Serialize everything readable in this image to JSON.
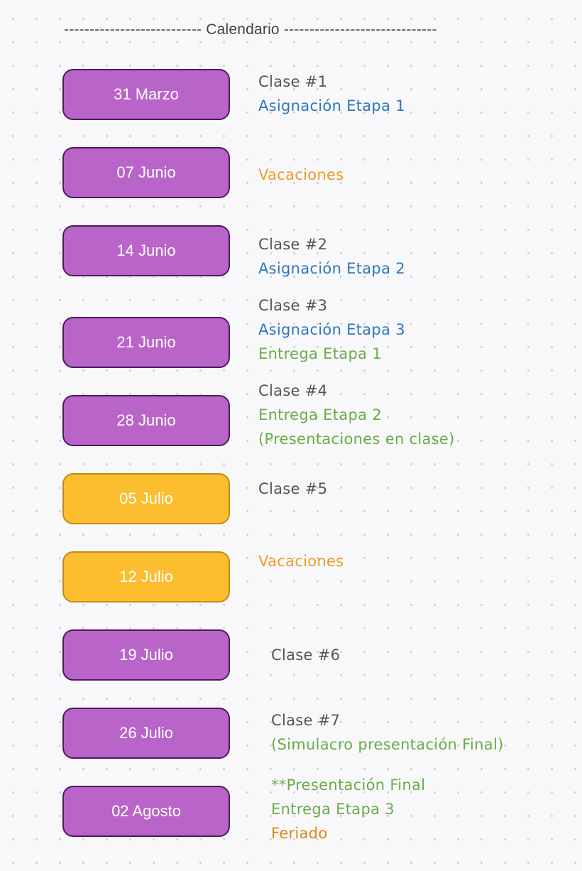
{
  "title": "--------------------------- Calendario ------------------------------",
  "colors": {
    "purple_box": "#b964c8",
    "purple_border": "#4e1a5c",
    "yellow_box": "#fcbd2f",
    "yellow_border": "#c48a17",
    "clase_text": "#555555",
    "asignacion_text": "#2f77b8",
    "entrega_text": "#6aac48",
    "vacaciones_text": "#f19a24"
  },
  "entries": [
    {
      "date": "31 Marzo",
      "box_color": "purple",
      "notes": [
        {
          "text": "Clase #1",
          "kind": "clase"
        },
        {
          "text": "Asignación Etapa 1",
          "kind": "asignacion"
        }
      ]
    },
    {
      "date": "07 Junio",
      "box_color": "purple",
      "notes": [
        {
          "text": "Vacaciones",
          "kind": "vacaciones"
        }
      ]
    },
    {
      "date": "14 Junio",
      "box_color": "purple",
      "notes": [
        {
          "text": "Clase #2",
          "kind": "clase"
        },
        {
          "text": "Asignación Etapa 2",
          "kind": "asignacion"
        }
      ]
    },
    {
      "date": "21 Junio",
      "box_color": "purple",
      "notes": [
        {
          "text": "Clase #3",
          "kind": "clase"
        },
        {
          "text": "Asignación Etapa 3",
          "kind": "asignacion"
        },
        {
          "text": "Entrega Etapa 1",
          "kind": "entrega"
        }
      ]
    },
    {
      "date": "28 Junio",
      "box_color": "purple",
      "notes": [
        {
          "text": "Clase #4",
          "kind": "clase"
        },
        {
          "text": "Entrega Etapa 2",
          "kind": "entrega"
        },
        {
          "text": "(Presentaciones en clase)",
          "kind": "entrega"
        }
      ]
    },
    {
      "date": "05 Julio",
      "box_color": "yellow",
      "notes": [
        {
          "text": "Clase #5",
          "kind": "clase"
        }
      ]
    },
    {
      "date": "12 Julio",
      "box_color": "yellow",
      "notes": [
        {
          "text": "Vacaciones",
          "kind": "vacaciones"
        }
      ]
    },
    {
      "date": "19 Julio",
      "box_color": "purple",
      "notes": [
        {
          "text": "Clase #6",
          "kind": "clase"
        }
      ]
    },
    {
      "date": "26 Julio",
      "box_color": "purple",
      "notes": [
        {
          "text": "Clase #7",
          "kind": "clase"
        },
        {
          "text": "(Simulacro presentación Final)",
          "kind": "entrega"
        }
      ]
    },
    {
      "date": "02 Agosto",
      "box_color": "purple",
      "notes": [
        {
          "text": "**Presentación Final",
          "kind": "entrega"
        },
        {
          "text": "Entrega Etapa 3",
          "kind": "entrega"
        },
        {
          "text": "Feriado",
          "kind": "feriado"
        }
      ]
    }
  ]
}
